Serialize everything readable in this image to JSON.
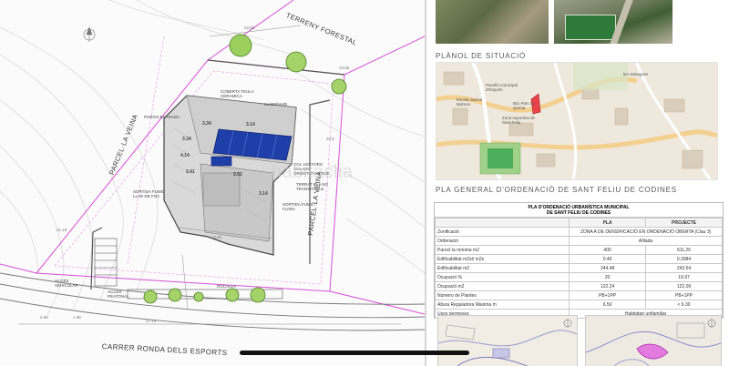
{
  "plan": {
    "terreny_forestal": "TERRENY FORESTAL",
    "parcella_veina_left": "PARCEL·LA VEINA",
    "parcella_veina_right": "PARCEL·LA VEINA",
    "carrer": "CARRER RONDA DELS ESPORTS",
    "labels": {
      "coberta": "COBERTA TEULA CERAMICA",
      "lluernari": "LLUERNARI",
      "porxo": "PORXO ENTRADA",
      "col_lectors": "COL·LECTORS SOLARS ORIENTATS A SUD",
      "terrat": "TERRAT PLA NO TRANSITABLE",
      "sortida_fum_llar": "SORTIDA FUMS LLAR DE FOC",
      "sortida_fum_cuina": "SORTIDA FUMS CUINA",
      "accés_vehicular": "ACCÉS VEHICULAR",
      "accés_peatonal": "ACCÉS PEATONAL",
      "rocalla": "ROCALLA"
    },
    "heights": [
      "3.34",
      "3.34",
      "4.14",
      "3.41",
      "3.52",
      "3.14",
      "3.14"
    ],
    "dims": [
      "22.50",
      "12.60",
      "21.18",
      "27.15",
      "13.86",
      "20.5",
      "4.60",
      "1.38"
    ]
  },
  "watermark": "habitaclia",
  "situacio": {
    "title": "PLÀNOL DE SITUACIÓ",
    "map_labels": [
      "les Sabogues",
      "Pavelló municipal d'Esports",
      "Escola Jaume Balmes",
      "Bici Parc La Quinta",
      "Zona esportiva de Sant Feliu"
    ]
  },
  "pla_general": {
    "title": "PLA GENERAL D'ORDENACIÓ DE SANT FELIU DE CODINES",
    "table_title_line1": "PLA D'ORDENACIÓ URBANÍSTICA MUNICIPAL",
    "table_title_line2": "DE SANT FELIU DE CODINES",
    "col_pla": "PLA",
    "col_projecte": "PROJECTE",
    "zonificacio_label": "Zonificació",
    "zonificacio_value": "ZONA A DE DENSIFICACIÓ EN ORDENACIÓ OBERTA (Clau 3)",
    "ordenacio_label": "Ordenació",
    "ordenacio_value": "Aïllada",
    "rows": [
      {
        "label": "Parcel·la mínima m2",
        "pla": "400",
        "projecte": "611,26"
      },
      {
        "label": "Edificabilitat m2st/ m2s",
        "pla": "0.40",
        "projecte": "0.3984"
      },
      {
        "label": "Edificabilitat m2",
        "pla": "244.48",
        "projecte": "243.54"
      },
      {
        "label": "Ocupació %",
        "pla": "20",
        "projecte": "19.97"
      },
      {
        "label": "Ocupació m2",
        "pla": "122.24",
        "projecte": "122.09"
      },
      {
        "label": "Número de Plantes",
        "pla": "PB+1PP",
        "projecte": "PB+1PP"
      },
      {
        "label": "Altura Reguladora Màxima m",
        "pla": "6.50",
        "projecte": "< 6.30"
      }
    ],
    "usos_label": "Usos permesos",
    "usos_value": "Habitatge unifamiliar"
  }
}
